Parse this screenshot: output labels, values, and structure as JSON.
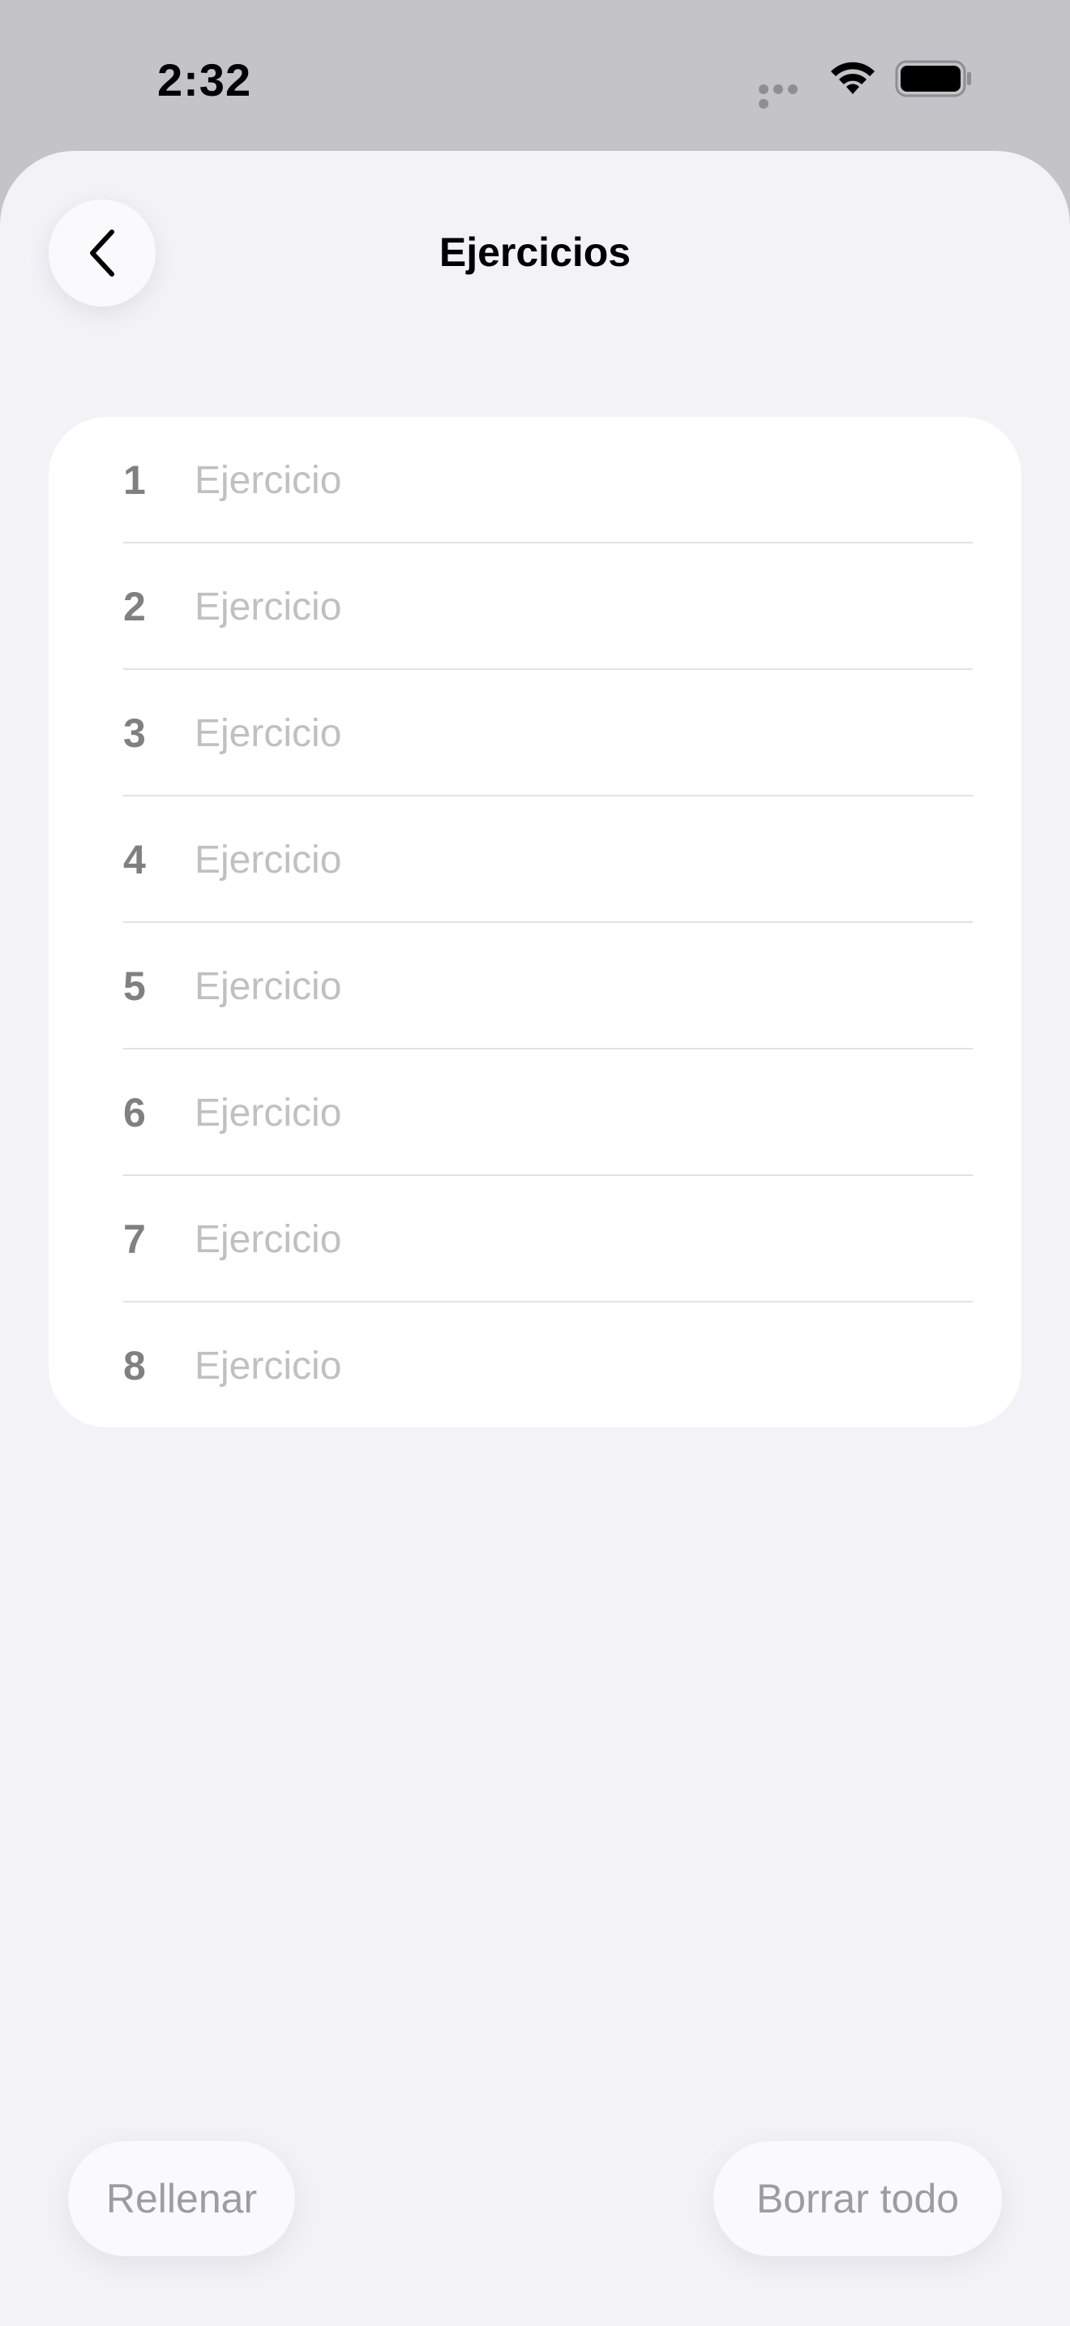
{
  "status_bar": {
    "time": "2:32"
  },
  "icons": {
    "wifi": "wifi-icon",
    "battery": "battery-icon",
    "signal": "cellular-signal-icon",
    "back": "chevron-left-icon"
  },
  "nav": {
    "title": "Ejercicios"
  },
  "exercises": [
    {
      "number": "1",
      "placeholder": "Ejercicio",
      "value": ""
    },
    {
      "number": "2",
      "placeholder": "Ejercicio",
      "value": ""
    },
    {
      "number": "3",
      "placeholder": "Ejercicio",
      "value": ""
    },
    {
      "number": "4",
      "placeholder": "Ejercicio",
      "value": ""
    },
    {
      "number": "5",
      "placeholder": "Ejercicio",
      "value": ""
    },
    {
      "number": "6",
      "placeholder": "Ejercicio",
      "value": ""
    },
    {
      "number": "7",
      "placeholder": "Ejercicio",
      "value": ""
    },
    {
      "number": "8",
      "placeholder": "Ejercicio",
      "value": ""
    }
  ],
  "actions": {
    "fill_label": "Rellenar",
    "clear_label": "Borrar todo"
  },
  "colors": {
    "background": "#f2f2f7",
    "card": "#ffffff",
    "placeholder": "#c0c0c4",
    "number": "#808080",
    "button_text": "#9c9ca1"
  }
}
